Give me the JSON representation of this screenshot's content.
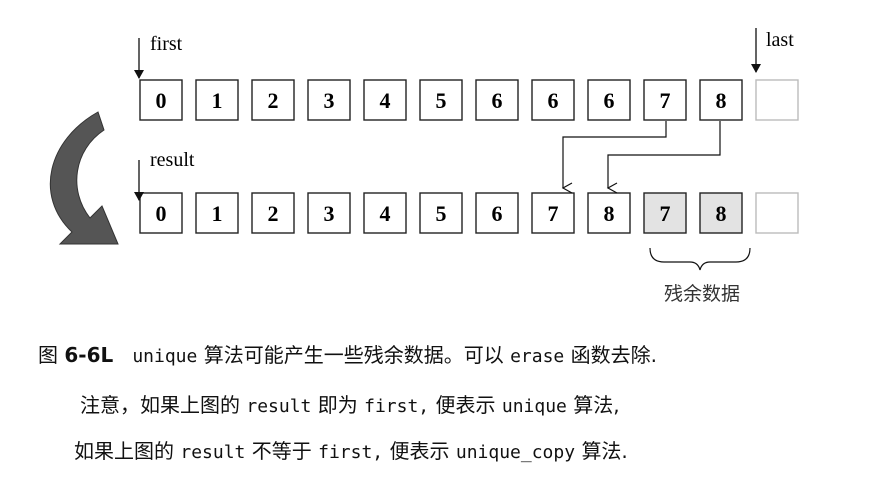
{
  "diagram": {
    "labels": {
      "first": "first",
      "last": "last",
      "result": "result",
      "residual": "残余数据"
    },
    "top_row": [
      "0",
      "1",
      "2",
      "3",
      "4",
      "5",
      "6",
      "6",
      "6",
      "7",
      "8",
      ""
    ],
    "bottom_row": [
      "0",
      "1",
      "2",
      "3",
      "4",
      "5",
      "6",
      "7",
      "8",
      "7",
      "8",
      ""
    ],
    "bottom_shaded": [
      false,
      false,
      false,
      false,
      false,
      false,
      false,
      false,
      false,
      true,
      true,
      false
    ],
    "colors": {
      "shaded": "#e3e3e3",
      "curved_arrow": "#555555"
    }
  },
  "caption": {
    "line1": {
      "fig_prefix": "图",
      "fig_num": "6-6L",
      "code1": "unique",
      "text1": "算法可能产生一些残余数据。可以",
      "code2": "erase",
      "text2": "函数去除."
    },
    "line2": {
      "text1": "注意，如果上图的",
      "code1": "result",
      "text2": "即为",
      "code2": "first,",
      "text3": "便表示",
      "code3": "unique",
      "text4": "算法,"
    },
    "line3": {
      "text1": "如果上图的",
      "code1": "result",
      "text2": "不等于",
      "code2": "first,",
      "text3": "便表示",
      "code3": "unique_copy",
      "text4": "算法."
    }
  }
}
